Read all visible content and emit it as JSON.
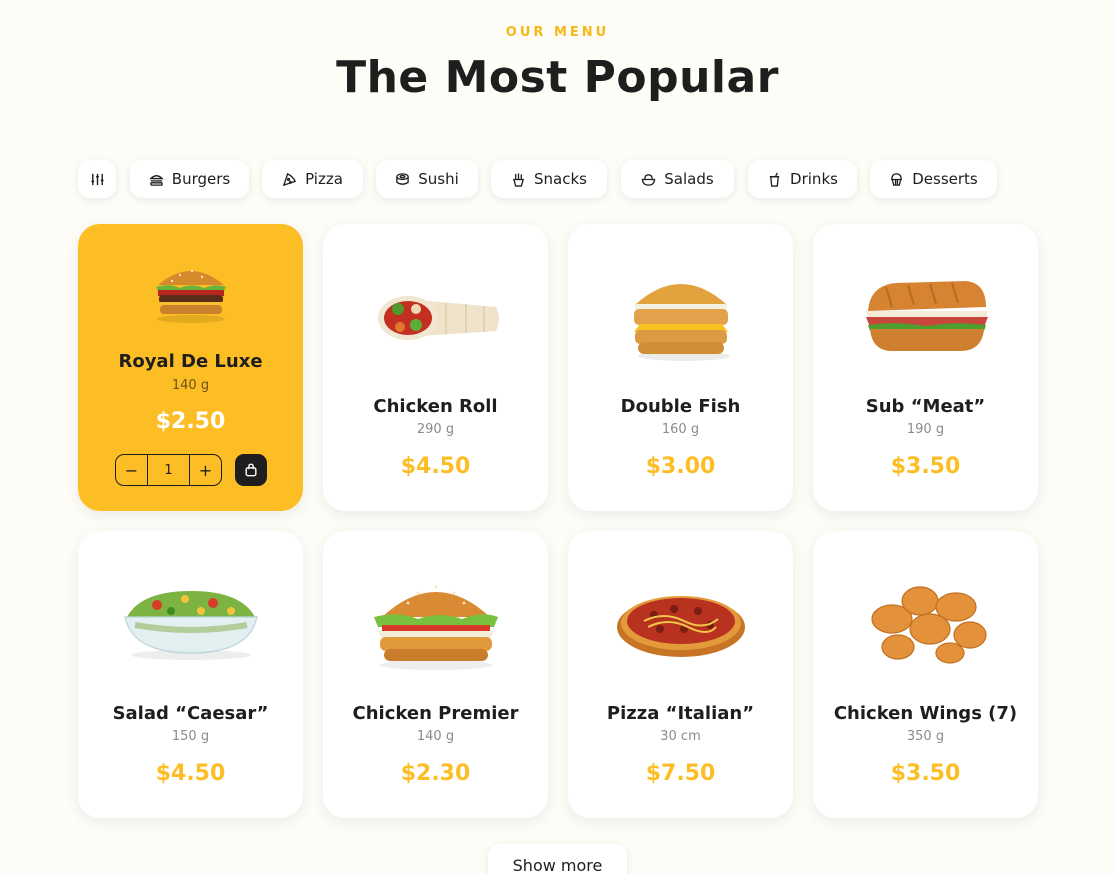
{
  "header": {
    "eyebrow": "OUR MENU",
    "title": "The Most Popular"
  },
  "filters": {
    "settings_icon": "sliders-icon",
    "items": [
      {
        "label": "Burgers",
        "icon": "burger-icon"
      },
      {
        "label": "Pizza",
        "icon": "pizza-icon"
      },
      {
        "label": "Sushi",
        "icon": "sushi-icon"
      },
      {
        "label": "Snacks",
        "icon": "fries-icon"
      },
      {
        "label": "Salads",
        "icon": "salad-bowl-icon"
      },
      {
        "label": "Drinks",
        "icon": "cup-icon"
      },
      {
        "label": "Desserts",
        "icon": "cupcake-icon"
      }
    ]
  },
  "products": [
    {
      "name": "Royal De Luxe",
      "weight": "140 g",
      "price": "$2.50",
      "image": "burger",
      "selected": true,
      "quantity": "1"
    },
    {
      "name": "Chicken Roll",
      "weight": "290 g",
      "price": "$4.50",
      "image": "wrap"
    },
    {
      "name": "Double Fish",
      "weight": "160 g",
      "price": "$3.00",
      "image": "fish-burger"
    },
    {
      "name": "Sub “Meat”",
      "weight": "190 g",
      "price": "$3.50",
      "image": "sub-sandwich"
    },
    {
      "name": "Salad “Caesar”",
      "weight": "150 g",
      "price": "$4.50",
      "image": "salad"
    },
    {
      "name": "Chicken Premier",
      "weight": "140 g",
      "price": "$2.30",
      "image": "chicken-burger"
    },
    {
      "name": "Pizza “Italian”",
      "weight": "30 cm",
      "price": "$7.50",
      "image": "pizza"
    },
    {
      "name": "Chicken Wings (7)",
      "weight": "350 g",
      "price": "$3.50",
      "image": "chicken-wings"
    }
  ],
  "show_more_label": "Show more",
  "colors": {
    "accent": "#fdbd25",
    "text": "#1e1e1e",
    "background": "#fdfcf7",
    "muted": "#8a8a8a"
  }
}
